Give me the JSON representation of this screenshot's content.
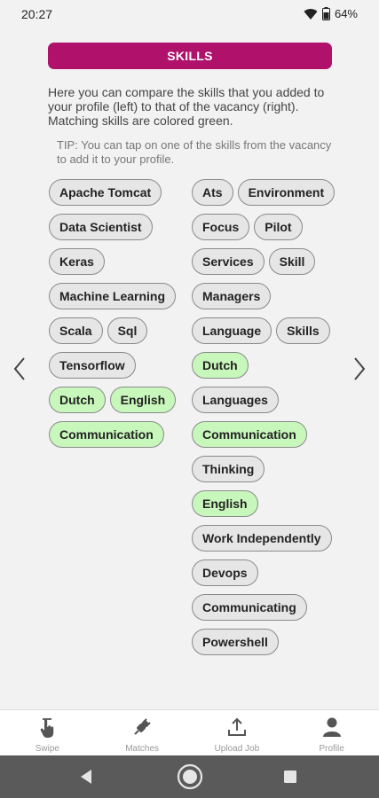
{
  "status_bar": {
    "time": "20:27",
    "battery": "64%"
  },
  "header": {
    "title": "SKILLS"
  },
  "intro_text": "Here you can compare the skills that you added to your profile (left) to that of the vacancy (right). Matching skills are colored green.",
  "tip_text": "TIP: You can tap on one of the skills from the vacancy to add it to your profile.",
  "profile_skills": [
    [
      "Apache Tomcat"
    ],
    [
      "Data Scientist"
    ],
    [
      "Keras"
    ],
    [
      "Machine Learning"
    ],
    [
      "Scala",
      "Sql"
    ],
    [
      "Tensorflow"
    ],
    [
      "Dutch",
      "English"
    ],
    [
      "Communication"
    ]
  ],
  "vacancy_skills": [
    [
      "Ats",
      "Environment"
    ],
    [
      "Focus",
      "Pilot"
    ],
    [
      "Services",
      "Skill"
    ],
    [
      "Managers"
    ],
    [
      "Language",
      "Skills"
    ],
    [
      "Dutch"
    ],
    [
      "Languages"
    ],
    [
      "Communication"
    ],
    [
      "Thinking"
    ],
    [
      "English"
    ],
    [
      "Work Independently"
    ],
    [
      "Devops"
    ],
    [
      "Communicating"
    ],
    [
      "Powershell"
    ]
  ],
  "matching_skills": [
    "Dutch",
    "English",
    "Communication"
  ],
  "colors": {
    "accent": "#b0126b",
    "match": "#c8f7bb",
    "chip": "#e6e6e6"
  },
  "bottom_nav": [
    {
      "label": "Swipe",
      "icon": "swipe-icon"
    },
    {
      "label": "Matches",
      "icon": "matches-icon"
    },
    {
      "label": "Upload Job",
      "icon": "upload-icon"
    },
    {
      "label": "Profile",
      "icon": "profile-icon"
    }
  ]
}
